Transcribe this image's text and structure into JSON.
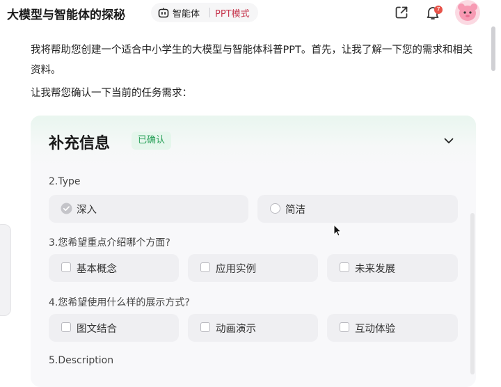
{
  "header": {
    "title": "大模型与智能体的探秘",
    "agent_label": "智能体",
    "mode_label": "PPT模式",
    "notification_count": "7"
  },
  "message": {
    "intro": "我将帮助您创建一个适合中小学生的大模型与智能体科普PPT。首先，让我了解一下您的需求和相关资料。",
    "confirm_prompt": "让我帮您确认一下当前的任务需求："
  },
  "card": {
    "title": "补充信息",
    "status": "已确认",
    "questions": [
      {
        "label": "2.Type",
        "options": [
          {
            "label": "深入",
            "selected": true
          },
          {
            "label": "简洁",
            "selected": false
          }
        ]
      },
      {
        "label": "3.您希望重点介绍哪个方面?",
        "options": [
          {
            "label": "基本概念",
            "checked": false
          },
          {
            "label": "应用实例",
            "checked": false
          },
          {
            "label": "未来发展",
            "checked": false
          }
        ]
      },
      {
        "label": "4.您希望使用什么样的展示方式?",
        "options": [
          {
            "label": "图文结合",
            "checked": false
          },
          {
            "label": "动画演示",
            "checked": false
          },
          {
            "label": "互动体验",
            "checked": false
          }
        ]
      },
      {
        "label": "5.Description"
      }
    ]
  },
  "icons": {
    "agent": "robot-icon",
    "share": "share-icon",
    "notification": "bell-icon",
    "collapse": "chevron-down-icon",
    "selected_radio": "check-circle-icon"
  },
  "colors": {
    "mode_accent": "#c6384f",
    "confirmed_green": "#2aa15a",
    "badge_red": "#e8534a"
  }
}
